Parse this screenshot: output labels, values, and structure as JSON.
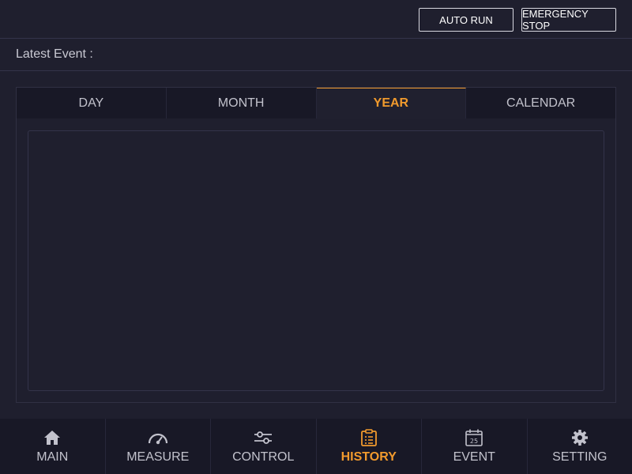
{
  "header": {
    "auto_run_label": "AUTO RUN",
    "emergency_stop_label": "EMERGENCY STOP"
  },
  "event": {
    "label": "Latest Event :",
    "value": ""
  },
  "tabs": [
    {
      "label": "DAY",
      "active": false
    },
    {
      "label": "MONTH",
      "active": false
    },
    {
      "label": "YEAR",
      "active": true
    },
    {
      "label": "CALENDAR",
      "active": false
    }
  ],
  "nav": [
    {
      "label": "MAIN",
      "icon": "home-icon",
      "active": false
    },
    {
      "label": "MEASURE",
      "icon": "gauge-icon",
      "active": false
    },
    {
      "label": "CONTROL",
      "icon": "sliders-icon",
      "active": false
    },
    {
      "label": "HISTORY",
      "icon": "clipboard-list-icon",
      "active": true
    },
    {
      "label": "EVENT",
      "icon": "calendar-icon",
      "active": false
    },
    {
      "label": "SETTING",
      "icon": "gear-icon",
      "active": false
    }
  ],
  "calendar_icon_day": "25",
  "colors": {
    "background": "#1f1f2e",
    "accent": "#f19a2d",
    "nav_background": "#181826"
  }
}
